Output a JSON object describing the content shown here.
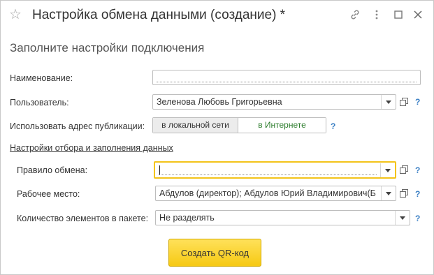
{
  "window": {
    "title": "Настройка обмена данными (создание) *",
    "icons": [
      "star-icon",
      "link-icon",
      "more-icon",
      "maximize-icon",
      "close-icon"
    ]
  },
  "form": {
    "subtitle": "Заполните настройки подключения",
    "name_label": "Наименование:",
    "name_value": "",
    "user_label": "Пользователь:",
    "user_value": "Зеленова Любовь Григорьевна",
    "publication_label": "Использовать адрес публикации:",
    "publication_options": [
      "в локальной сети",
      "в Интернете"
    ],
    "publication_selected": "в локальной сети",
    "section_title": "Настройки отбора и заполнения данных",
    "exchange_rule_label": "Правило обмена:",
    "exchange_rule_value": "",
    "workplace_label": "Рабочее место:",
    "workplace_value": "Абдулов (директор); Абдулов Юрий Владимирович(Б",
    "batch_label": "Количество элементов в пакете:",
    "batch_value": "Не разделять",
    "help": "?",
    "create_qr_label": "Создать QR-код"
  },
  "colors": {
    "accent_yellow": "#f6c913",
    "help_blue": "#3a7fc4",
    "internet_green": "#2d7d2d"
  }
}
